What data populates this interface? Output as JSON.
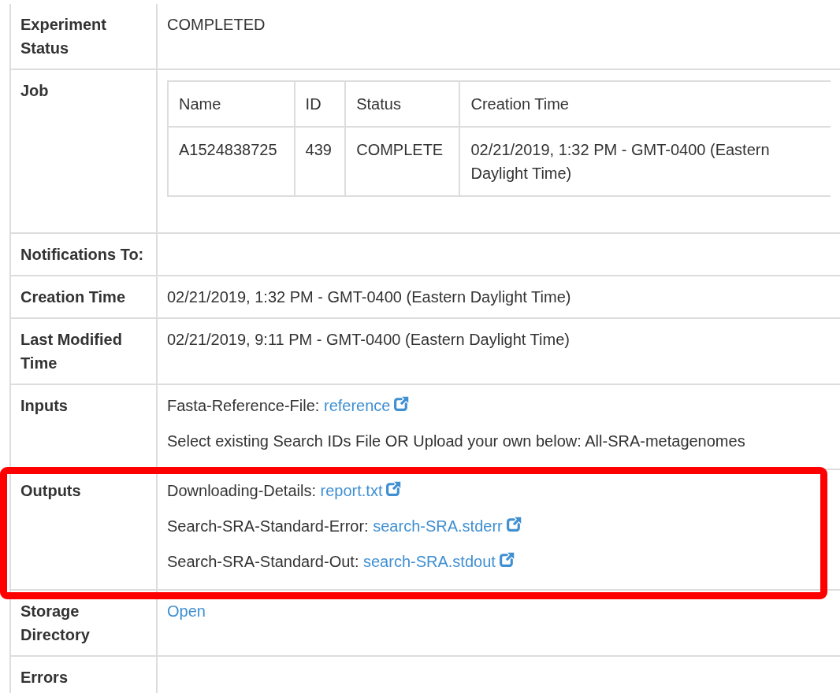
{
  "rows": [
    {
      "label": "Experiment Status",
      "kind": "text",
      "value": "COMPLETED",
      "highlighted": false
    },
    {
      "label": "Job",
      "kind": "job_table",
      "highlighted": false,
      "columns": [
        "Name",
        "ID",
        "Status",
        "Creation Time"
      ],
      "rows": [
        [
          "A1524838725",
          "439",
          "COMPLETE",
          "02/21/2019, 1:32 PM - GMT-0400 (Eastern Daylight Time)"
        ]
      ]
    },
    {
      "label": "Notifications To:",
      "kind": "empty",
      "highlighted": false
    },
    {
      "label": "Creation Time",
      "kind": "text",
      "value": "02/21/2019, 1:32 PM - GMT-0400 (Eastern Daylight Time)",
      "highlighted": false
    },
    {
      "label": "Last Modified Time",
      "kind": "text",
      "value": "02/21/2019, 9:11 PM - GMT-0400 (Eastern Daylight Time)",
      "highlighted": false
    },
    {
      "label": "Inputs",
      "kind": "files",
      "highlighted": false,
      "items": [
        {
          "name": "Fasta-Reference-File:",
          "link": "reference"
        },
        {
          "name": "Select existing Search IDs File OR Upload your own below: All-SRA-metagenomes"
        }
      ]
    },
    {
      "label": "Outputs",
      "kind": "files",
      "highlighted": true,
      "items": [
        {
          "name": "Downloading-Details:",
          "link": "report.txt"
        },
        {
          "name": "Search-SRA-Standard-Error:",
          "link": "search-SRA.stderr"
        },
        {
          "name": "Search-SRA-Standard-Out:",
          "link": "search-SRA.stdout"
        }
      ]
    },
    {
      "label": "Storage Directory",
      "kind": "link",
      "value": "Open",
      "highlighted": false
    },
    {
      "label": "Errors",
      "kind": "empty",
      "highlighted": false
    }
  ]
}
